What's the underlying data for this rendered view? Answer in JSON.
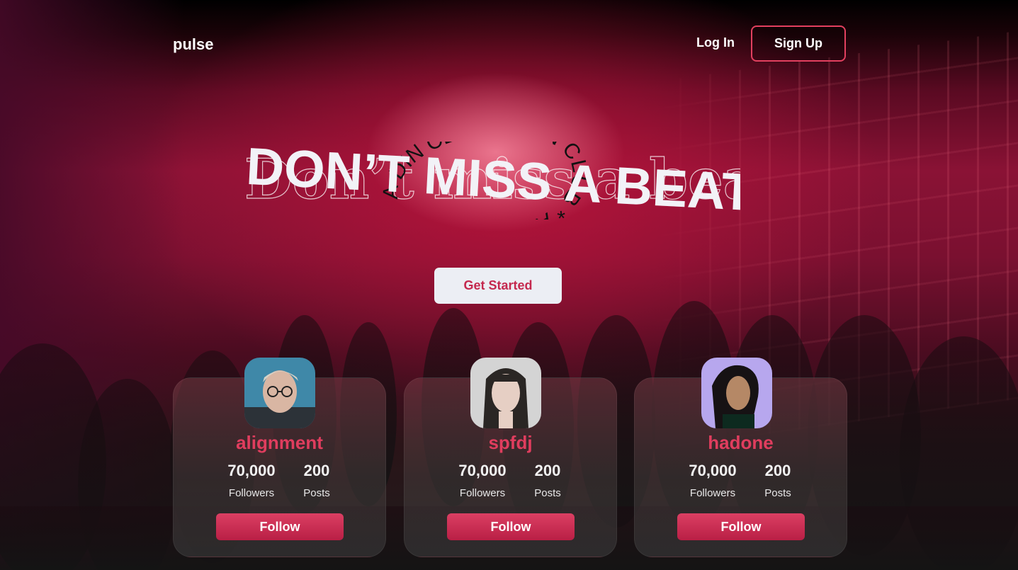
{
  "nav": {
    "logo": "pulse",
    "login_label": "Log In",
    "signup_label": "Sign Up"
  },
  "hero": {
    "title": "DON’T MISS A BEAT",
    "echo_title": "Don’t miss a beat",
    "circle_text": "A DIN CLUB * A DIN CLUB * A DIN CLUB *",
    "cta_label": "Get Started"
  },
  "colors": {
    "accent": "#e03d5e",
    "button_light": "#eceef4"
  },
  "artists": [
    {
      "name": "alignment",
      "followers": "70,000",
      "followers_label": "Followers",
      "posts": "200",
      "posts_label": "Posts",
      "follow_label": "Follow"
    },
    {
      "name": "spfdj",
      "followers": "70,000",
      "followers_label": "Followers",
      "posts": "200",
      "posts_label": "Posts",
      "follow_label": "Follow"
    },
    {
      "name": "hadone",
      "followers": "70,000",
      "followers_label": "Followers",
      "posts": "200",
      "posts_label": "Posts",
      "follow_label": "Follow"
    }
  ]
}
